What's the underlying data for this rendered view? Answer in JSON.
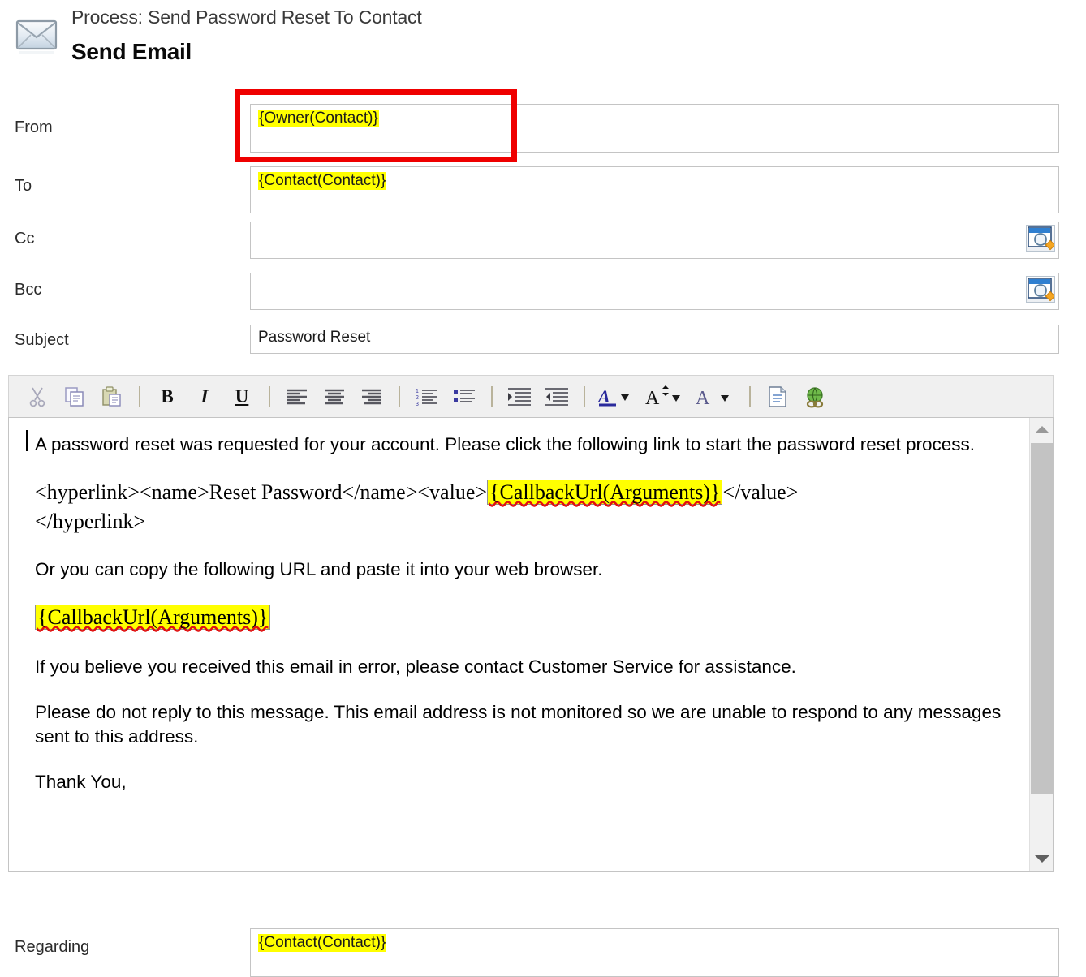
{
  "header": {
    "icon": "envelope-icon",
    "subtitle": "Process: Send Password Reset To Contact",
    "title": "Send Email"
  },
  "form": {
    "fields": [
      {
        "label": "From",
        "value": "{Owner(Contact)}",
        "highlighted": true,
        "lookup": false
      },
      {
        "label": "To",
        "value": "{Contact(Contact)}",
        "highlighted": true,
        "lookup": false
      },
      {
        "label": "Cc",
        "value": "",
        "highlighted": false,
        "lookup": true
      },
      {
        "label": "Bcc",
        "value": "",
        "highlighted": false,
        "lookup": true
      },
      {
        "label": "Subject",
        "value": "Password Reset",
        "highlighted": false,
        "lookup": false
      }
    ],
    "regarding": {
      "label": "Regarding",
      "value": "{Contact(Contact)}",
      "highlighted": true
    }
  },
  "annotation": {
    "name": "red-highlight-box",
    "color": "#ef0000",
    "targets": "From field"
  },
  "toolbar": {
    "buttons": [
      {
        "name": "cut-icon",
        "label": "Cut"
      },
      {
        "name": "copy-icon",
        "label": "Copy"
      },
      {
        "name": "paste-icon",
        "label": "Paste"
      },
      {
        "name": "bold-icon",
        "label": "B"
      },
      {
        "name": "italic-icon",
        "label": "I"
      },
      {
        "name": "underline-icon",
        "label": "U"
      },
      {
        "name": "align-left-icon",
        "label": "Align Left"
      },
      {
        "name": "align-center-icon",
        "label": "Align Center"
      },
      {
        "name": "align-right-icon",
        "label": "Align Right"
      },
      {
        "name": "numbered-list-icon",
        "label": "Numbered List"
      },
      {
        "name": "bulleted-list-icon",
        "label": "Bulleted List"
      },
      {
        "name": "increase-indent-icon",
        "label": "Increase Indent"
      },
      {
        "name": "decrease-indent-icon",
        "label": "Decrease Indent"
      },
      {
        "name": "font-color-icon",
        "label": "Font Color"
      },
      {
        "name": "font-size-icon",
        "label": "Font Size"
      },
      {
        "name": "font-name-icon",
        "label": "Font"
      },
      {
        "name": "source-icon",
        "label": "Edit Source"
      },
      {
        "name": "insert-link-icon",
        "label": "Insert Link"
      }
    ]
  },
  "body": {
    "para1": "A password reset was requested for your account. Please click the following link to start the password reset process.",
    "hyperlink_line": {
      "before": "<hyperlink><name>Reset Password</name><value>",
      "token": "{CallbackUrl(Arguments)}",
      "after": "</value>",
      "close_tag": "</hyperlink>"
    },
    "para2": "Or you can copy the following URL and paste it into your web browser.",
    "token_line": "{CallbackUrl(Arguments)}",
    "para3": "If you believe you received this email in error, please contact Customer Service for assistance.",
    "para4": "Please do not reply to this message. This email address is not monitored so we are unable to respond to any messages sent to this address.",
    "para5": "Thank You,"
  },
  "scrollbar": {
    "up_arrow": "scroll-up-arrow-icon",
    "down_arrow": "scroll-down-arrow-icon"
  },
  "colors": {
    "highlight": "#ffff00",
    "annotation": "#ef0000",
    "toolbar_bg": "#f0f0f0",
    "field_border": "#c4c4c4",
    "scrollbar_thumb": "#c3c3c3"
  }
}
